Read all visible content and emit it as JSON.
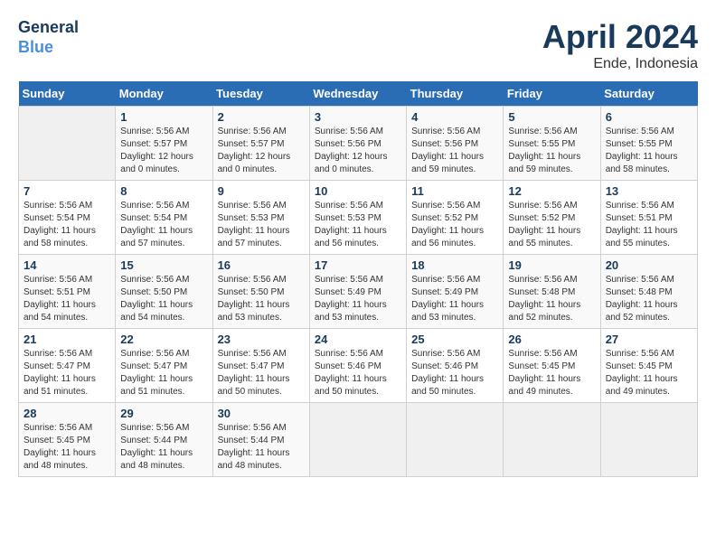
{
  "header": {
    "logo_line1": "General",
    "logo_line2": "Blue",
    "month": "April 2024",
    "location": "Ende, Indonesia"
  },
  "days_of_week": [
    "Sunday",
    "Monday",
    "Tuesday",
    "Wednesday",
    "Thursday",
    "Friday",
    "Saturday"
  ],
  "weeks": [
    [
      {
        "day": "",
        "info": ""
      },
      {
        "day": "1",
        "info": "Sunrise: 5:56 AM\nSunset: 5:57 PM\nDaylight: 12 hours\nand 0 minutes."
      },
      {
        "day": "2",
        "info": "Sunrise: 5:56 AM\nSunset: 5:57 PM\nDaylight: 12 hours\nand 0 minutes."
      },
      {
        "day": "3",
        "info": "Sunrise: 5:56 AM\nSunset: 5:56 PM\nDaylight: 12 hours\nand 0 minutes."
      },
      {
        "day": "4",
        "info": "Sunrise: 5:56 AM\nSunset: 5:56 PM\nDaylight: 11 hours\nand 59 minutes."
      },
      {
        "day": "5",
        "info": "Sunrise: 5:56 AM\nSunset: 5:55 PM\nDaylight: 11 hours\nand 59 minutes."
      },
      {
        "day": "6",
        "info": "Sunrise: 5:56 AM\nSunset: 5:55 PM\nDaylight: 11 hours\nand 58 minutes."
      }
    ],
    [
      {
        "day": "7",
        "info": "Sunrise: 5:56 AM\nSunset: 5:54 PM\nDaylight: 11 hours\nand 58 minutes."
      },
      {
        "day": "8",
        "info": "Sunrise: 5:56 AM\nSunset: 5:54 PM\nDaylight: 11 hours\nand 57 minutes."
      },
      {
        "day": "9",
        "info": "Sunrise: 5:56 AM\nSunset: 5:53 PM\nDaylight: 11 hours\nand 57 minutes."
      },
      {
        "day": "10",
        "info": "Sunrise: 5:56 AM\nSunset: 5:53 PM\nDaylight: 11 hours\nand 56 minutes."
      },
      {
        "day": "11",
        "info": "Sunrise: 5:56 AM\nSunset: 5:52 PM\nDaylight: 11 hours\nand 56 minutes."
      },
      {
        "day": "12",
        "info": "Sunrise: 5:56 AM\nSunset: 5:52 PM\nDaylight: 11 hours\nand 55 minutes."
      },
      {
        "day": "13",
        "info": "Sunrise: 5:56 AM\nSunset: 5:51 PM\nDaylight: 11 hours\nand 55 minutes."
      }
    ],
    [
      {
        "day": "14",
        "info": "Sunrise: 5:56 AM\nSunset: 5:51 PM\nDaylight: 11 hours\nand 54 minutes."
      },
      {
        "day": "15",
        "info": "Sunrise: 5:56 AM\nSunset: 5:50 PM\nDaylight: 11 hours\nand 54 minutes."
      },
      {
        "day": "16",
        "info": "Sunrise: 5:56 AM\nSunset: 5:50 PM\nDaylight: 11 hours\nand 53 minutes."
      },
      {
        "day": "17",
        "info": "Sunrise: 5:56 AM\nSunset: 5:49 PM\nDaylight: 11 hours\nand 53 minutes."
      },
      {
        "day": "18",
        "info": "Sunrise: 5:56 AM\nSunset: 5:49 PM\nDaylight: 11 hours\nand 53 minutes."
      },
      {
        "day": "19",
        "info": "Sunrise: 5:56 AM\nSunset: 5:48 PM\nDaylight: 11 hours\nand 52 minutes."
      },
      {
        "day": "20",
        "info": "Sunrise: 5:56 AM\nSunset: 5:48 PM\nDaylight: 11 hours\nand 52 minutes."
      }
    ],
    [
      {
        "day": "21",
        "info": "Sunrise: 5:56 AM\nSunset: 5:47 PM\nDaylight: 11 hours\nand 51 minutes."
      },
      {
        "day": "22",
        "info": "Sunrise: 5:56 AM\nSunset: 5:47 PM\nDaylight: 11 hours\nand 51 minutes."
      },
      {
        "day": "23",
        "info": "Sunrise: 5:56 AM\nSunset: 5:47 PM\nDaylight: 11 hours\nand 50 minutes."
      },
      {
        "day": "24",
        "info": "Sunrise: 5:56 AM\nSunset: 5:46 PM\nDaylight: 11 hours\nand 50 minutes."
      },
      {
        "day": "25",
        "info": "Sunrise: 5:56 AM\nSunset: 5:46 PM\nDaylight: 11 hours\nand 50 minutes."
      },
      {
        "day": "26",
        "info": "Sunrise: 5:56 AM\nSunset: 5:45 PM\nDaylight: 11 hours\nand 49 minutes."
      },
      {
        "day": "27",
        "info": "Sunrise: 5:56 AM\nSunset: 5:45 PM\nDaylight: 11 hours\nand 49 minutes."
      }
    ],
    [
      {
        "day": "28",
        "info": "Sunrise: 5:56 AM\nSunset: 5:45 PM\nDaylight: 11 hours\nand 48 minutes."
      },
      {
        "day": "29",
        "info": "Sunrise: 5:56 AM\nSunset: 5:44 PM\nDaylight: 11 hours\nand 48 minutes."
      },
      {
        "day": "30",
        "info": "Sunrise: 5:56 AM\nSunset: 5:44 PM\nDaylight: 11 hours\nand 48 minutes."
      },
      {
        "day": "",
        "info": ""
      },
      {
        "day": "",
        "info": ""
      },
      {
        "day": "",
        "info": ""
      },
      {
        "day": "",
        "info": ""
      }
    ]
  ]
}
